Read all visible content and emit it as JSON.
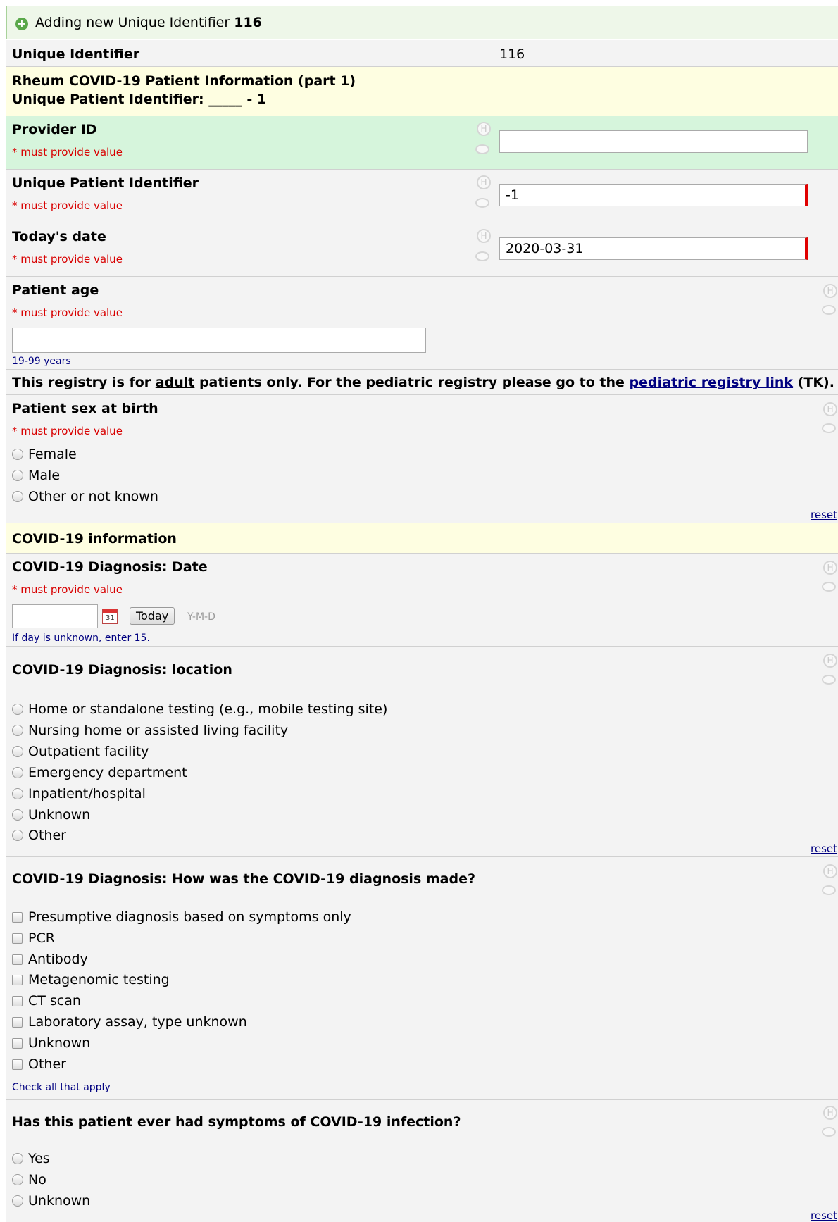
{
  "header": {
    "prefix": "Adding new Unique Identifier",
    "number": "116"
  },
  "record": {
    "label": "Unique Identifier",
    "value": "116"
  },
  "section1": {
    "line1": "Rheum COVID-19 Patient Information (part 1)",
    "line2": "Unique Patient Identifier: _____ - 1"
  },
  "required_note": "* must provide value",
  "fields": {
    "provider_id": {
      "label": "Provider ID",
      "value": ""
    },
    "upi": {
      "label": "Unique Patient Identifier",
      "value": "-1"
    },
    "today": {
      "label": "Today's date",
      "value": "2020-03-31"
    },
    "age": {
      "label": "Patient age",
      "value": "",
      "note": "19-99 years"
    }
  },
  "registry_notice": {
    "part1": "This registry is for ",
    "adult": "adult",
    "part2": " patients only.  For the pediatric registry please go to the ",
    "link": "pediatric registry link",
    "part3": " (TK)."
  },
  "sex": {
    "label": "Patient sex at birth",
    "options": [
      "Female",
      "Male",
      "Other or not known"
    ]
  },
  "reset_label": "reset",
  "section2": {
    "title": "COVID-19 information"
  },
  "dx_date": {
    "label": "COVID-19 Diagnosis: Date",
    "today_button": "Today",
    "format": "Y-M-D",
    "note": "If day is unknown, enter 15.",
    "calendar_day": "31"
  },
  "dx_location": {
    "label": "COVID-19 Diagnosis: location",
    "options": [
      "Home or standalone testing (e.g., mobile testing site)",
      "Nursing home or assisted living facility",
      "Outpatient facility",
      "Emergency department",
      "Inpatient/hospital",
      "Unknown",
      "Other"
    ]
  },
  "dx_method": {
    "label": "COVID-19 Diagnosis: How was the COVID-19 diagnosis made?",
    "options": [
      "Presumptive diagnosis based on symptoms only",
      "PCR",
      "Antibody",
      "Metagenomic testing",
      "CT scan",
      "Laboratory assay, type unknown",
      "Unknown",
      "Other"
    ],
    "note": "Check all that apply"
  },
  "symptoms": {
    "label": "Has this patient ever had symptoms of COVID-19 infection?",
    "options": [
      "Yes",
      "No",
      "Unknown"
    ]
  },
  "colors": {
    "header_bg": "#eef7e9",
    "section_bg": "#fefee1",
    "provider_bg": "#d6f5dc",
    "required": "#d80000",
    "note": "#000080"
  }
}
